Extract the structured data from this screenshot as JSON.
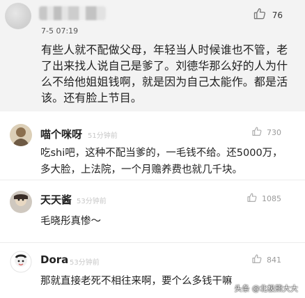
{
  "top_comment": {
    "avatar_icon": "avatar-icon",
    "timestamp": "7-5 07:19",
    "like_count": "76",
    "like_icon": "thumbs-up-icon",
    "text": "有些人就不配做父母，年轻当人时候谁也不管，老了出来找人说自己是爹了。刘德华那么好的人为什么不给他姐姐钱啊，就是因为自己太能作。都是活该。还有脸上节目。"
  },
  "comments": [
    {
      "name": "喵个咪呀",
      "time": "51分钟前",
      "likes": "730",
      "text": "吃shi吧，这种不配当爹的，一毛钱不给。还5000万，多大脸，上法院，一个月赡养费也就几千块。"
    },
    {
      "name": "天天酱",
      "time": "53分钟前",
      "likes": "1085",
      "text": "毛晓彤真惨～"
    },
    {
      "name": "Dora",
      "time": "53分钟前",
      "likes": "841",
      "text": "那就直接老死不相往来啊，要个么多钱干嘛"
    }
  ],
  "watermark": "头条 @北极熊大大",
  "colors": {
    "top_background": "#f3f3f3",
    "muted_text": "#9a9a9a",
    "faint_time": "#c7c7c7"
  }
}
